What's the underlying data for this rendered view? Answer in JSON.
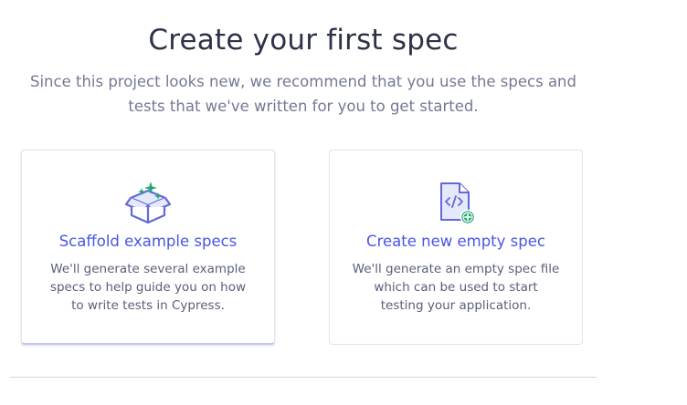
{
  "header": {
    "title": "Create your first spec",
    "subtitle": "Since this project looks new, we recommend that you use the specs and tests that we've written for you to get started."
  },
  "cards": [
    {
      "title": "Scaffold example specs",
      "description": "We'll generate several example specs to help guide you on how to write tests in Cypress.",
      "icon": "box-sparkle-icon"
    },
    {
      "title": "Create new empty spec",
      "description": "We'll generate an empty spec file which can be used to start testing your application.",
      "icon": "file-code-add-icon"
    }
  ],
  "colors": {
    "accent": "#4956e3",
    "icon_purple": "#6169d8",
    "icon_fill": "#e6e8fb",
    "icon_green": "#21a86e",
    "title": "#2e3247",
    "muted": "#747994"
  }
}
